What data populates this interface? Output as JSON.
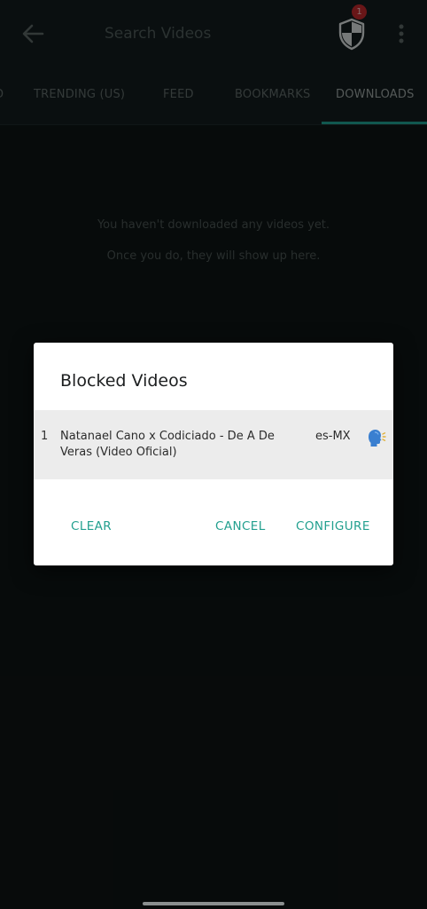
{
  "appbar": {
    "search_placeholder": "Search Videos",
    "back_icon": "arrow-left-icon",
    "shield_icon": "shield-icon",
    "shield_badge_count": "1",
    "more_icon": "more-vert-icon"
  },
  "tabs": [
    {
      "label": "D"
    },
    {
      "label": "TRENDING (US)"
    },
    {
      "label": "FEED"
    },
    {
      "label": "BOOKMARKS"
    },
    {
      "label": "DOWNLOADS"
    }
  ],
  "active_tab": "DOWNLOADS",
  "empty_state": {
    "line1": "You haven't downloaded any videos yet.",
    "line2": "Once you do,  they will show up here."
  },
  "dialog": {
    "title": "Blocked Videos",
    "items": [
      {
        "index": "1",
        "title": "Natanael Cano x Codiciado - De A De Veras (Video Oficial)",
        "language": "es-MX",
        "icon": "speaking-head-icon"
      }
    ],
    "clear_label": "CLEAR",
    "cancel_label": "CANCEL",
    "configure_label": "CONFIGURE"
  },
  "colors": {
    "accent": "#23a08f",
    "background": "#0e1414",
    "appbar": "#131c1e",
    "badge": "#c0282c"
  }
}
